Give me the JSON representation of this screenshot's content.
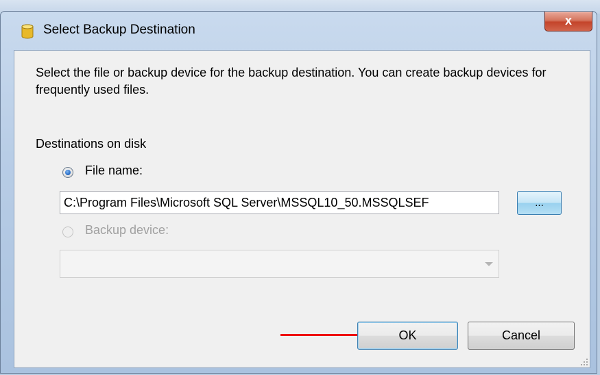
{
  "window": {
    "title": "Select Backup Destination",
    "close_glyph": "x",
    "icon": "database-icon"
  },
  "description": "Select the file or backup device for the backup destination. You can create backup devices for frequently used files.",
  "destinations": {
    "group_label": "Destinations on disk",
    "file_option": {
      "label": "File name:",
      "selected": true
    },
    "file_path": "C:\\Program Files\\Microsoft SQL Server\\MSSQL10_50.MSSQLSEF",
    "browse_label": "...",
    "device_option": {
      "label": "Backup device:",
      "selected": false,
      "enabled": false
    },
    "device_value": ""
  },
  "buttons": {
    "ok": "OK",
    "cancel": "Cancel"
  },
  "colors": {
    "annotation_arrow": "#ee1111",
    "accent": "#3c7fb1"
  }
}
